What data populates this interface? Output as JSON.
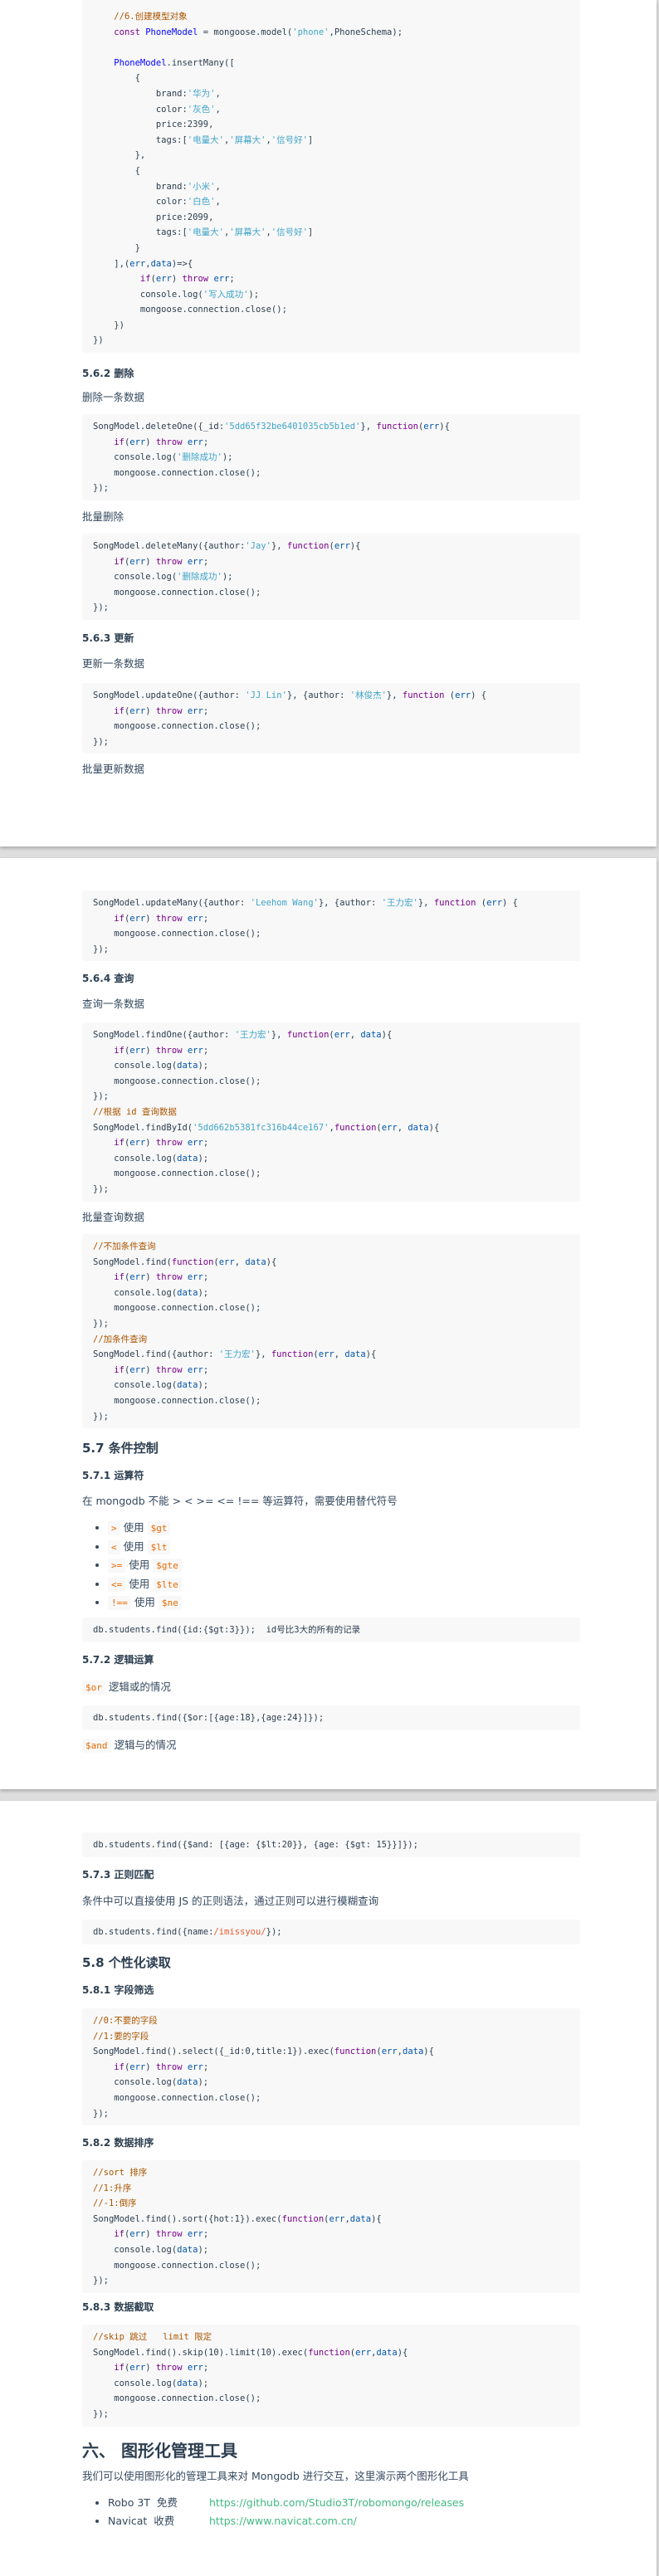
{
  "theme": {
    "keyword": "#770088",
    "def": "#0000ff",
    "variable": "#0055aa",
    "string": "#41a5c9",
    "number": "#116644",
    "comment": "#aa5500",
    "regex": "#e45a2c",
    "text": "#2c3e50",
    "inline_code": "#e96900",
    "link": "#42b983"
  },
  "code_blocks": [
    [
      "    //6.创建模型对象",
      "    const PhoneModel = mongoose.model('phone',PhoneSchema);",
      "",
      "    PhoneModel.insertMany([",
      "        {",
      "            brand:'华为',",
      "            color:'灰色',",
      "            price:2399,",
      "            tags:['电量大','屏幕大','信号好']",
      "        },",
      "        {",
      "            brand:'小米',",
      "            color:'白色',",
      "            price:2099,",
      "            tags:['电量大','屏幕大','信号好']",
      "        }",
      "    ],(err,data)=>{",
      "         if(err) throw err;",
      "         console.log('写入成功');",
      "         mongoose.connection.close();",
      "    })",
      "})"
    ],
    [
      "SongModel.deleteOne({_id:'5dd65f32be6401035cb5b1ed'}, function(err){",
      "    if(err) throw err;",
      "    console.log('删除成功');",
      "    mongoose.connection.close();",
      "});"
    ],
    [
      "SongModel.deleteMany({author:'Jay'}, function(err){",
      "    if(err) throw err;",
      "    console.log('删除成功');",
      "    mongoose.connection.close();",
      "});"
    ],
    [
      "SongModel.updateOne({author: 'JJ Lin'}, {author: '林俊杰'}, function (err) {",
      "    if(err) throw err;",
      "    mongoose.connection.close();",
      "});"
    ],
    [
      "SongModel.updateMany({author: 'Leehom Wang'}, {author: '王力宏'}, function (err) {",
      "    if(err) throw err;",
      "    mongoose.connection.close();",
      "});"
    ],
    [
      "SongModel.findOne({author: '王力宏'}, function(err, data){",
      "    if(err) throw err;",
      "    console.log(data);",
      "    mongoose.connection.close();",
      "});",
      "//根据 id 查询数据",
      "SongModel.findById('5dd662b5381fc316b44ce167',function(err, data){",
      "    if(err) throw err;",
      "    console.log(data);",
      "    mongoose.connection.close();",
      "});"
    ],
    [
      "//不加条件查询",
      "SongModel.find(function(err, data){",
      "    if(err) throw err;",
      "    console.log(data);",
      "    mongoose.connection.close();",
      "});",
      "//加条件查询",
      "SongModel.find({author: '王力宏'}, function(err, data){",
      "    if(err) throw err;",
      "    console.log(data);",
      "    mongoose.connection.close();",
      "});"
    ],
    [
      "db.students.find({id:{$gt:3}});  id号比3大的所有的记录"
    ],
    [
      "db.students.find({$or:[{age:18},{age:24}]});"
    ],
    [
      "db.students.find({$and: [{age: {$lt:20}}, {age: {$gt: 15}}]});"
    ],
    [
      "db.students.find({name:/imissyou/});"
    ],
    [
      "//0:不要的字段",
      "//1:要的字段",
      "SongModel.find().select({_id:0,title:1}).exec(function(err,data){",
      "    if(err) throw err;",
      "    console.log(data);",
      "    mongoose.connection.close();",
      "});"
    ],
    [
      "//sort 排序",
      "//1:升序",
      "//-1:倒序",
      "SongModel.find().sort({hot:1}).exec(function(err,data){",
      "    if(err) throw err;",
      "    console.log(data);",
      "    mongoose.connection.close();",
      "});"
    ],
    [
      "//skip 跳过   limit 限定",
      "SongModel.find().skip(10).limit(10).exec(function(err,data){",
      "    if(err) throw err;",
      "    console.log(data);",
      "    mongoose.connection.close();",
      "});"
    ]
  ],
  "text": {
    "h_562": "5.6.2 删除",
    "p_delete_one": "删除一条数据",
    "p_delete_many": "批量删除",
    "h_563": "5.6.3 更新",
    "p_update_one": "更新一条数据",
    "p_update_many": "批量更新数据",
    "h_564": "5.6.4 查询",
    "p_find_one": "查询一条数据",
    "p_find_many": "批量查询数据",
    "h_57": "5.7 条件控制",
    "h_571": "5.7.1 运算符",
    "p_ops": "在 mongodb 不能 > < >= <= !== 等运算符，需要使用替代符号",
    "h_572": "5.7.2 逻辑运算",
    "p_or": "逻辑或的情况",
    "p_and": "逻辑与的情况",
    "or_code": "$or",
    "and_code": "$and",
    "h_573": "5.7.3 正则匹配",
    "p_regex": "条件中可以直接使用 JS 的正则语法，通过正则可以进行模糊查询",
    "h_58": "5.8 个性化读取",
    "h_581": "5.8.1 字段筛选",
    "h_582": "5.8.2 数据排序",
    "h_583": "5.8.3 数据截取",
    "h_6": "六、 图形化管理工具",
    "p_tools": "我们可以使用图形化的管理工具来对 Mongodb 进行交互，这里演示两个图形化工具"
  },
  "operators": [
    {
      "op": ">",
      "use": "使用",
      "alt": "$gt"
    },
    {
      "op": "<",
      "use": "使用",
      "alt": "$lt"
    },
    {
      "op": ">=",
      "use": "使用",
      "alt": "$gte"
    },
    {
      "op": "<=",
      "use": "使用",
      "alt": "$lte"
    },
    {
      "op": "!==",
      "use": "使用",
      "alt": "$ne"
    }
  ],
  "tools": [
    {
      "name": "Robo 3T  免费",
      "url": "https://github.com/Studio3T/robomongo/releases"
    },
    {
      "name": "Navicat  收费",
      "url": "https://www.navicat.com.cn/"
    }
  ]
}
